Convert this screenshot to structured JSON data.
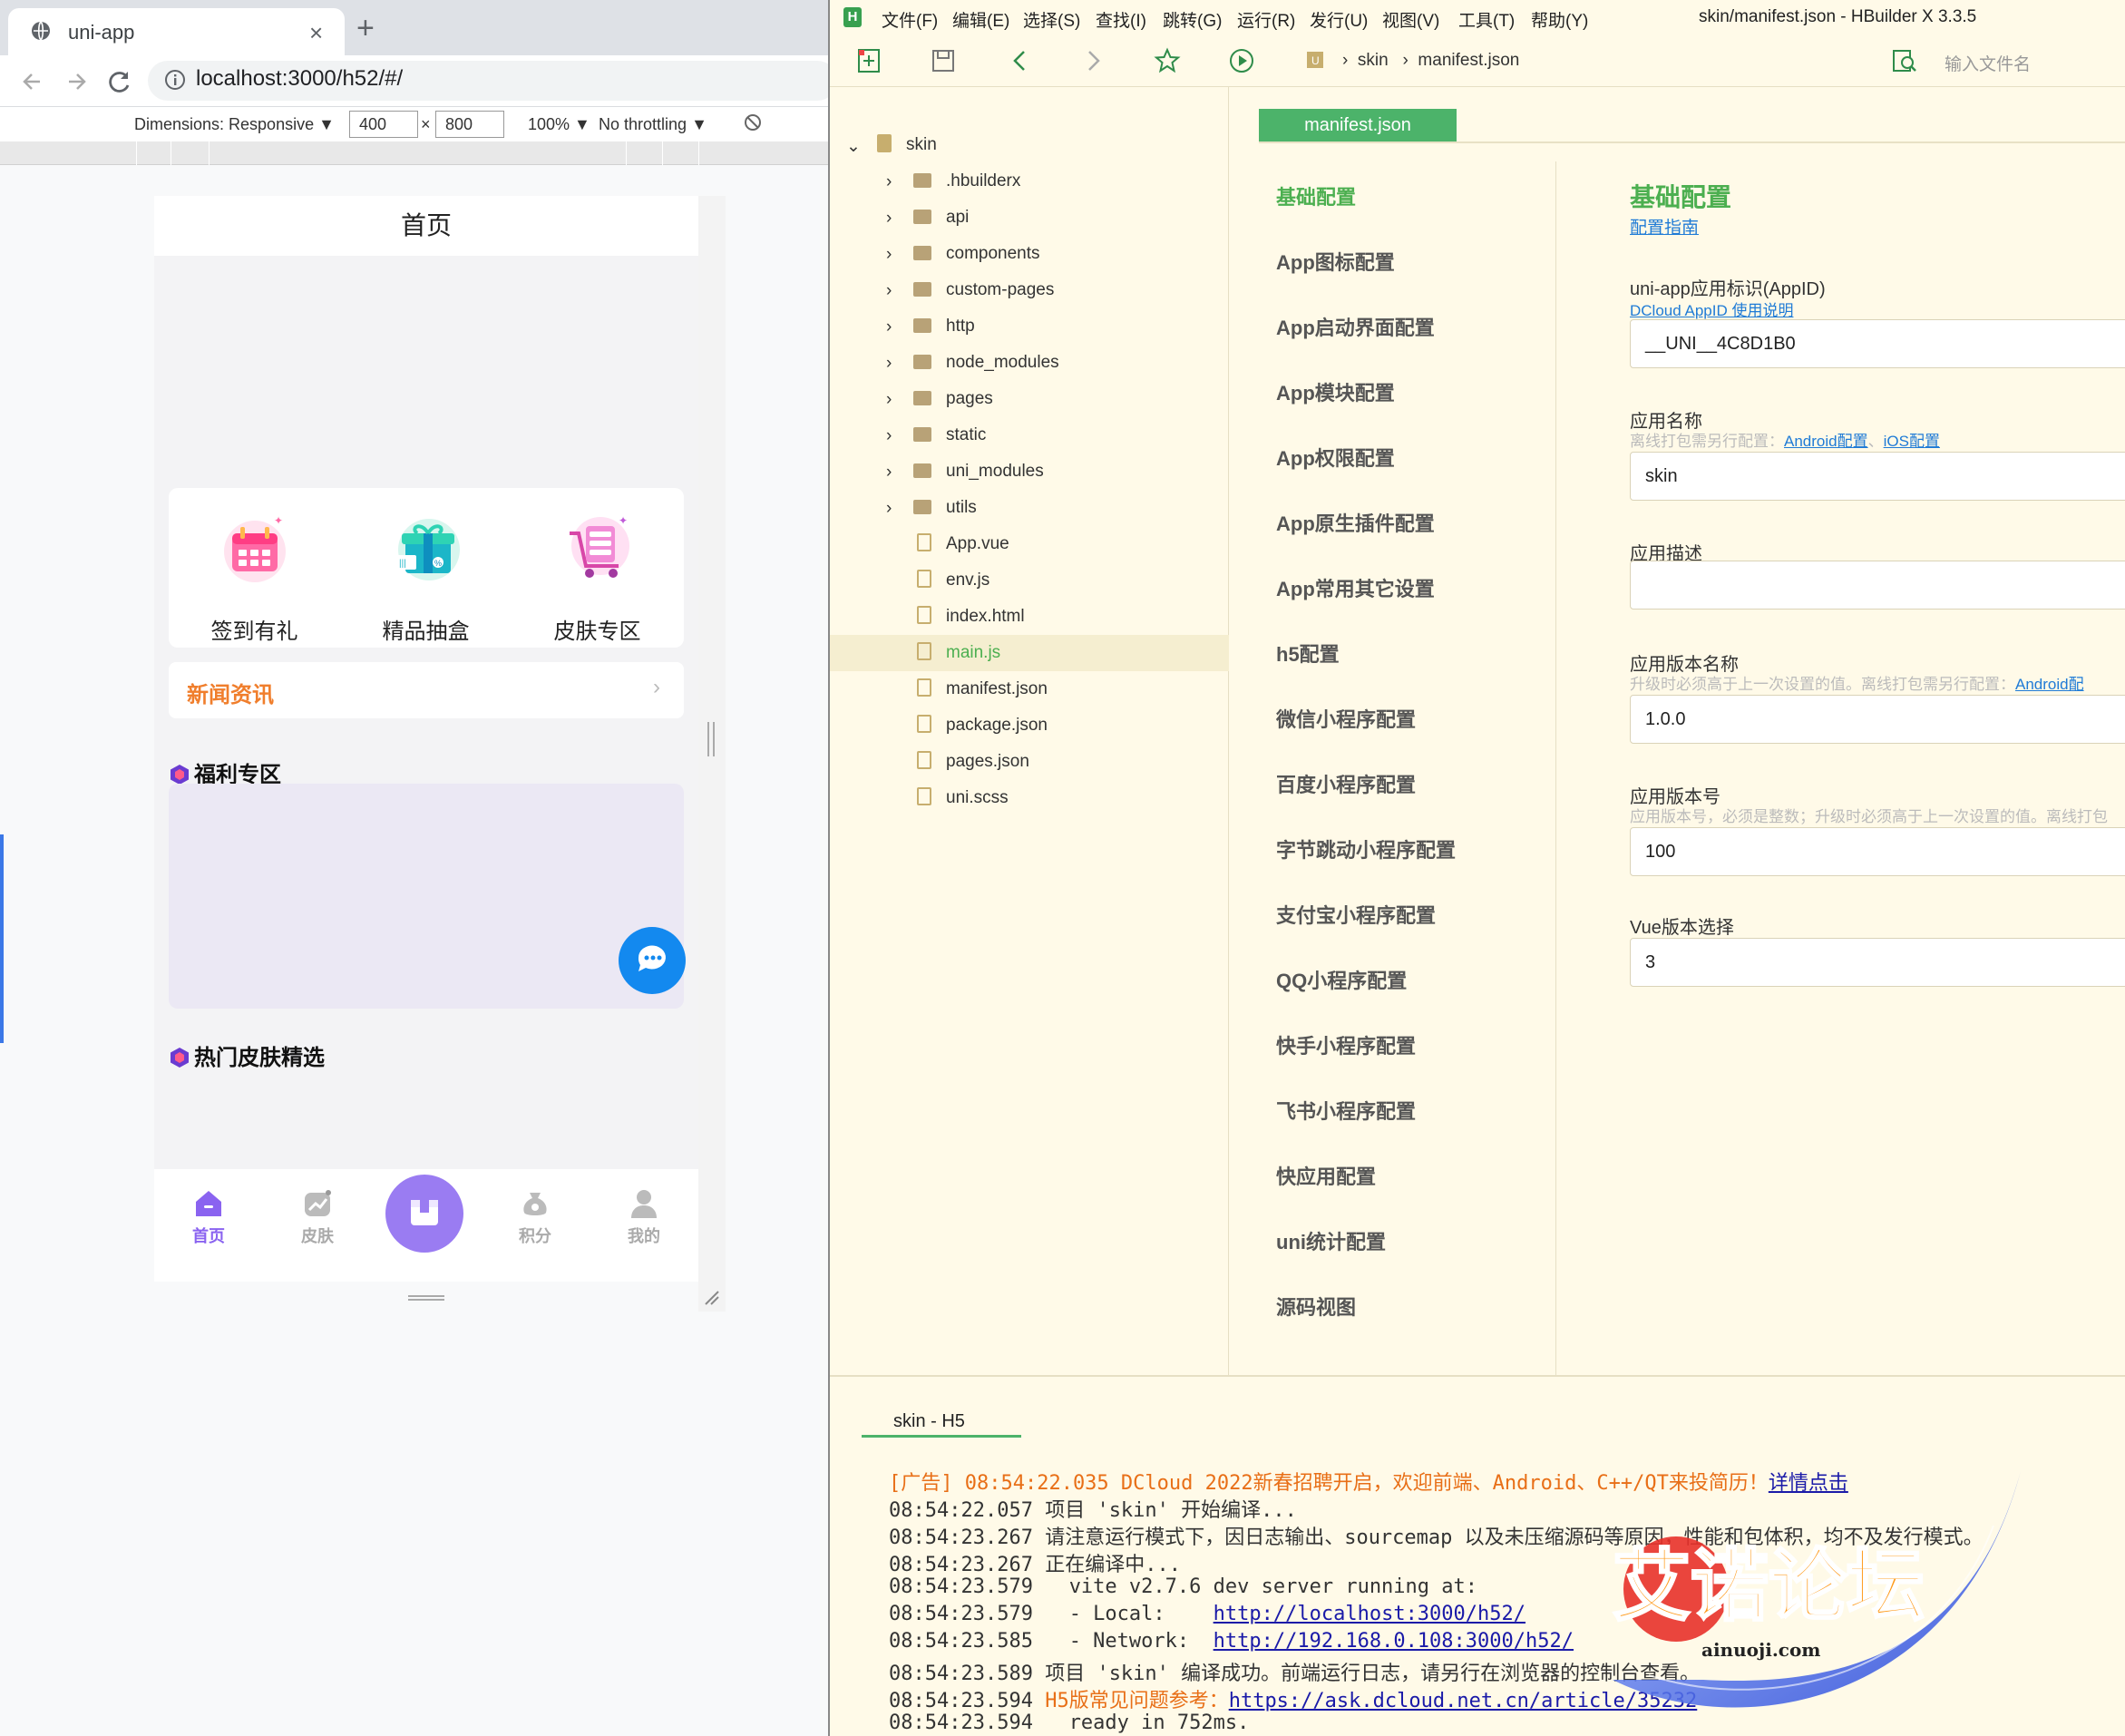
{
  "browser": {
    "tab_title": "uni-app",
    "url": "localhost:3000/h52/#/",
    "devtools": {
      "dimensions_label": "Dimensions: Responsive",
      "width": "400",
      "times": "×",
      "height": "800",
      "zoom": "100%",
      "throttling": "No throttling"
    }
  },
  "app": {
    "nav_title": "首页",
    "quick_entries": [
      {
        "label": "签到有礼",
        "icon": "calendar-gift-icon"
      },
      {
        "label": "精品抽盒",
        "icon": "gift-box-icon"
      },
      {
        "label": "皮肤专区",
        "icon": "cart-icon"
      }
    ],
    "news_title": "新闻资讯",
    "welfare_title": "福利专区",
    "hot_title": "热门皮肤精选",
    "tabbar": [
      {
        "label": "首页",
        "active": true
      },
      {
        "label": "皮肤",
        "active": false
      },
      {
        "label": "",
        "center": true
      },
      {
        "label": "积分",
        "active": false
      },
      {
        "label": "我的",
        "active": false
      }
    ],
    "accent_color": "#9a7cf2",
    "chat_color": "#1389ef"
  },
  "hbuilder": {
    "window_title": "skin/manifest.json - HBuilder X 3.3.5",
    "menus": [
      "文件(F)",
      "编辑(E)",
      "选择(S)",
      "查找(I)",
      "跳转(G)",
      "运行(R)",
      "发行(U)",
      "视图(V)",
      "工具(T)",
      "帮助(Y)"
    ],
    "breadcrumb": {
      "project": "skin",
      "file": "manifest.json"
    },
    "search_placeholder": "输入文件名",
    "tree_root": "skin",
    "tree_folders": [
      ".hbuilderx",
      "api",
      "components",
      "custom-pages",
      "http",
      "node_modules",
      "pages",
      "static",
      "uni_modules",
      "utils"
    ],
    "tree_files": [
      "App.vue",
      "env.js",
      "index.html",
      "main.js",
      "manifest.json",
      "package.json",
      "pages.json",
      "uni.scss"
    ],
    "selected_file": "main.js",
    "editor_tab": "manifest.json",
    "config_nav": [
      "基础配置",
      "App图标配置",
      "App启动界面配置",
      "App模块配置",
      "App权限配置",
      "App原生插件配置",
      "App常用其它设置",
      "h5配置",
      "微信小程序配置",
      "百度小程序配置",
      "字节跳动小程序配置",
      "支付宝小程序配置",
      "QQ小程序配置",
      "快手小程序配置",
      "飞书小程序配置",
      "快应用配置",
      "uni统计配置",
      "源码视图"
    ],
    "form": {
      "title": "基础配置",
      "guide_link": "配置指南",
      "appid_label": "uni-app应用标识(AppID)",
      "appid_link": "DCloud AppID 使用说明",
      "appid_value": "__UNI__4C8D1B0",
      "name_label": "应用名称",
      "name_hint": "离线打包需另行配置：",
      "name_link_android": "Android配置",
      "name_link_sep": "、",
      "name_link_ios": "iOS配置",
      "name_value": "skin",
      "desc_label": "应用描述",
      "desc_value": "",
      "version_name_label": "应用版本名称",
      "version_name_hint": "升级时必须高于上一次设置的值。离线打包需另行配置：",
      "version_name_link": "Android配",
      "version_name_value": "1.0.0",
      "version_code_label": "应用版本号",
      "version_code_hint": "应用版本号，必须是整数；升级时必须高于上一次设置的值。离线打包",
      "version_code_value": "100",
      "vue_label": "Vue版本选择",
      "vue_value": "3"
    },
    "console": {
      "tab": "skin - H5",
      "lines": [
        {
          "time": "[广告] 08:54:22.035",
          "text": " DCloud 2022新春招聘开启，欢迎前端、Android、C++/QT来投简历！",
          "link": "详情点击",
          "orange": true
        },
        {
          "time": "08:54:22.057",
          "text": " 项目 'skin' 开始编译..."
        },
        {
          "time": "08:54:23.267",
          "text": " 请注意运行模式下，因日志输出、sourcemap 以及未压缩源码等原因，性能和包体积，均不及发行模式。"
        },
        {
          "time": "08:54:23.267",
          "text": " 正在编译中..."
        },
        {
          "time": "08:54:23.579",
          "text": "   vite v2.7.6 dev server running at:"
        },
        {
          "time": "08:54:23.579",
          "text": "   - Local:    ",
          "link": "http://localhost:3000/h52/"
        },
        {
          "time": "08:54:23.585",
          "text": "   - Network:  ",
          "link": "http://192.168.0.108:3000/h52/"
        },
        {
          "time": "08:54:23.589",
          "text": " 项目 'skin' 编译成功。前端运行日志，请另行在浏览器的控制台查看。"
        },
        {
          "time": "08:54:23.594",
          "text": " H5版常见问题参考：",
          "link": "https://ask.dcloud.net.cn/article/35232",
          "orange_text": true
        },
        {
          "time": "08:54:23.594",
          "text": "   ready in 752ms."
        }
      ]
    },
    "watermark": {
      "title": "艾诺论坛",
      "site": "ainuoji.com"
    }
  }
}
